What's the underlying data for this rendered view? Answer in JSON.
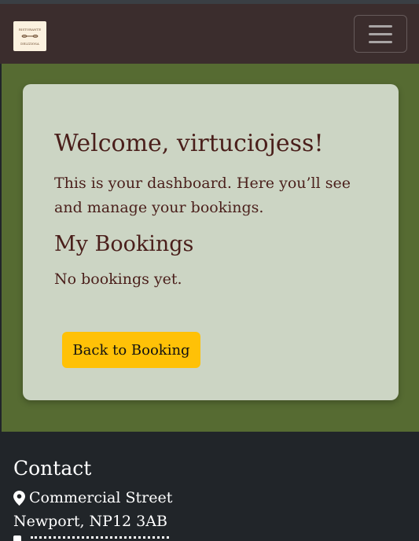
{
  "header": {
    "logo_text": [
      "RISTORANTE",
      "DELIZIOSA"
    ]
  },
  "dashboard": {
    "welcome": "Welcome, virtuciojess!",
    "intro": "This is your dashboard. Here you’ll see and manage your bookings.",
    "bookings_title": "My Bookings",
    "empty_message": "No bookings yet.",
    "back_button_label": "Back to Booking"
  },
  "footer": {
    "contact_title": "Contact",
    "address_line1": "Commercial Street",
    "address_line2": "Newport, NP12 3AB"
  },
  "colors": {
    "navbar": "#3b2d2d",
    "main_bg": "#566b32",
    "card_bg": "#ccd5c4",
    "heading_text": "#4a1f1b",
    "button": "#ffc107",
    "footer_bg": "#212529"
  },
  "icons": {
    "menu": "hamburger-icon",
    "address": "map-marker-icon"
  }
}
